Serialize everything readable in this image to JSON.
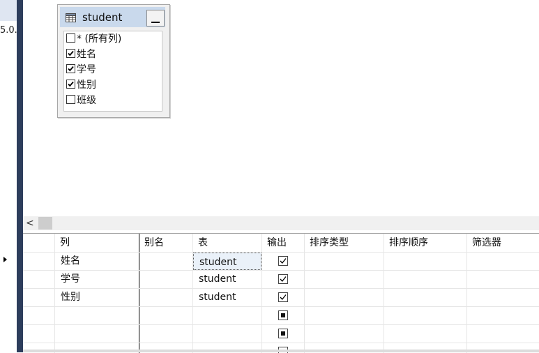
{
  "left_panel": {
    "truncated_text": "5.0.."
  },
  "table_widget": {
    "title": "student",
    "columns": [
      {
        "label": "* (所有列)",
        "checked": false
      },
      {
        "label": "姓名",
        "checked": true
      },
      {
        "label": "学号",
        "checked": true
      },
      {
        "label": "性别",
        "checked": true
      },
      {
        "label": "班级",
        "checked": false
      }
    ]
  },
  "scrollbar": {
    "left_arrow": "<"
  },
  "grid": {
    "headers": [
      "列",
      "别名",
      "表",
      "输出",
      "排序类型",
      "排序顺序",
      "筛选器"
    ],
    "rows": [
      {
        "column": "姓名",
        "alias": "",
        "table": "student",
        "output": "checked",
        "current": true
      },
      {
        "column": "学号",
        "alias": "",
        "table": "student",
        "output": "checked",
        "current": false
      },
      {
        "column": "性别",
        "alias": "",
        "table": "student",
        "output": "checked",
        "current": false
      },
      {
        "column": "",
        "alias": "",
        "table": "",
        "output": "indeterminate",
        "current": false
      },
      {
        "column": "",
        "alias": "",
        "table": "",
        "output": "indeterminate",
        "current": false
      }
    ]
  }
}
